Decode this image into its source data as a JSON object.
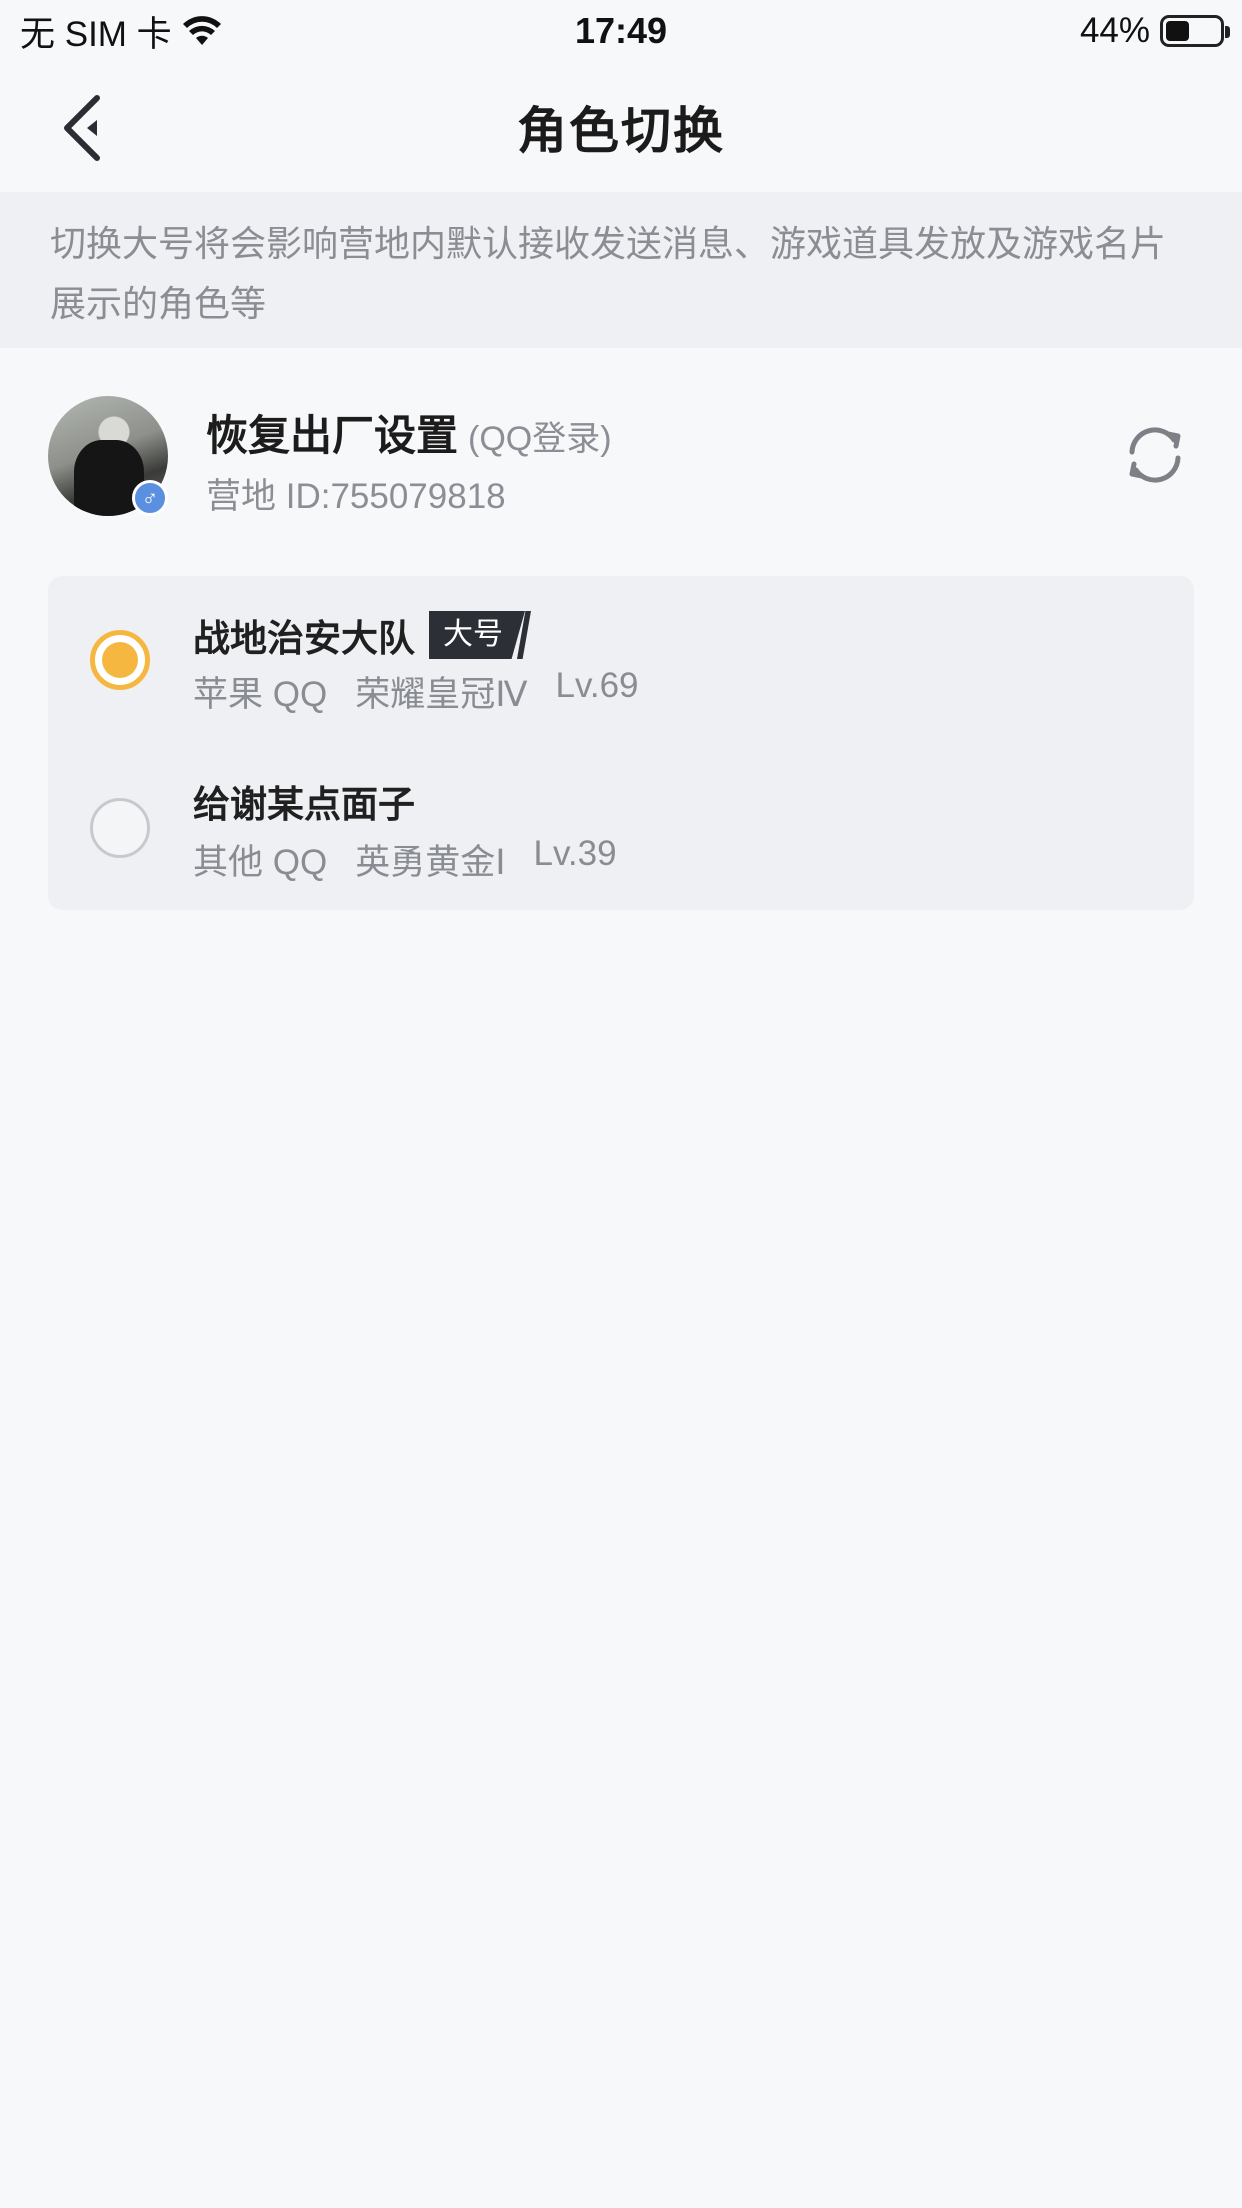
{
  "status_bar": {
    "carrier": "无 SIM 卡",
    "time": "17:49",
    "battery_percent": "44%",
    "battery_level": 0.44
  },
  "nav": {
    "title": "角色切换",
    "back_icon": "chevron-left-icon"
  },
  "notice": {
    "text": "切换大号将会影响营地内默认接收发送消息、游戏道具发放及游戏名片展示的角色等"
  },
  "account": {
    "name": "恢复出厂设置",
    "login_type": "(QQ登录)",
    "camp_id": "营地 ID:755079818",
    "gender_symbol": "♂",
    "refresh_icon": "refresh-icon"
  },
  "roles": [
    {
      "name": "战地治安大队",
      "tag": "大号",
      "platform": "苹果 QQ",
      "rank": "荣耀皇冠Ⅳ",
      "level": "Lv.69",
      "selected": true
    },
    {
      "name": "给谢某点面子",
      "tag": "",
      "platform": "其他 QQ",
      "rank": "英勇黄金Ⅰ",
      "level": "Lv.39",
      "selected": false
    }
  ],
  "colors": {
    "accent": "#f5b740",
    "background": "#f7f8fa",
    "notice_bg": "#eff0f3",
    "tag_bg": "#2d2f37",
    "gender_badge": "#5b8fe0"
  }
}
